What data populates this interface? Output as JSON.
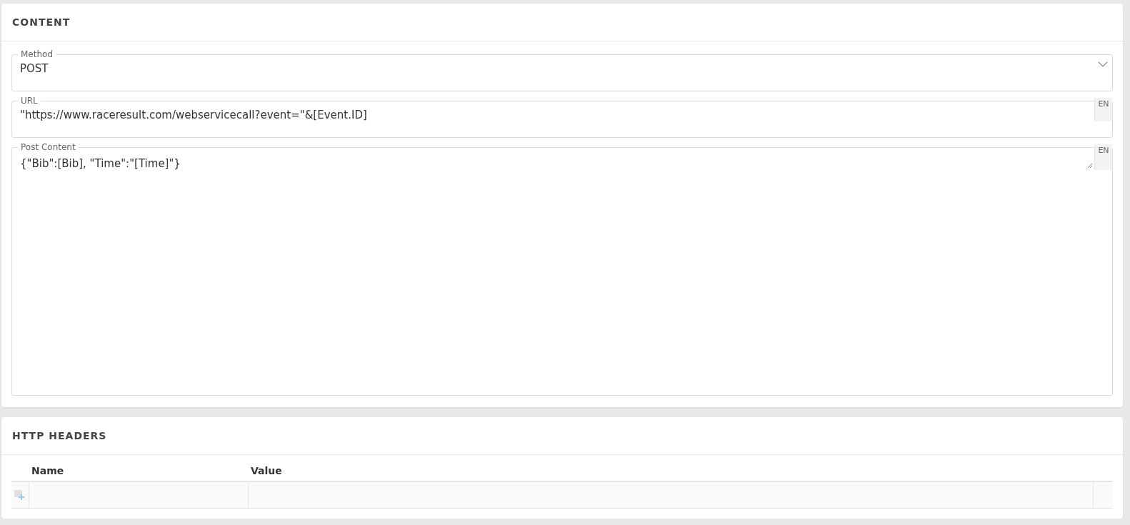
{
  "content": {
    "title": "CONTENT",
    "fields": [
      {
        "kind": "select",
        "label": "Method",
        "value": "POST"
      },
      {
        "kind": "text",
        "label": "URL",
        "value": "\"https://www.raceresult.com/webservicecall?event=\"&[Event.ID]",
        "language": "EN"
      },
      {
        "kind": "textarea",
        "label": "Post Content",
        "value": "{\"Bib\":[Bib], \"Time\":\"[Time]\"}",
        "language": "EN"
      }
    ]
  },
  "http_headers": {
    "title": "HTTP HEADERS",
    "columns": [
      "Name",
      "Value"
    ]
  }
}
